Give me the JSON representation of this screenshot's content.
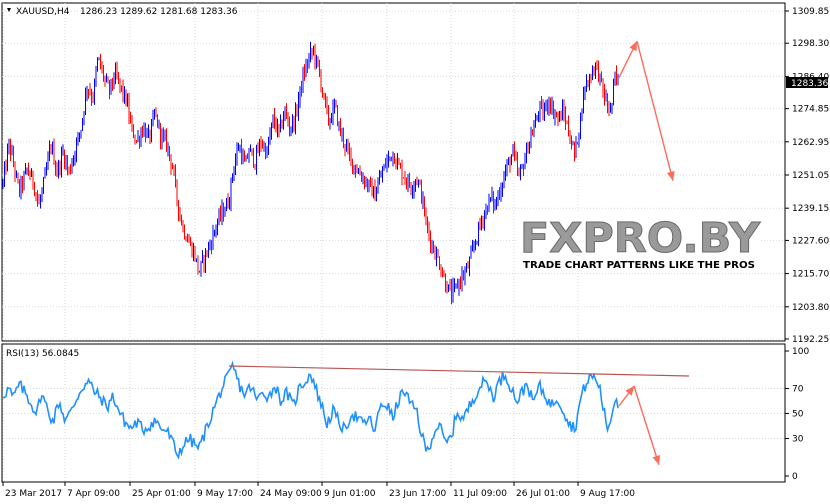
{
  "header": {
    "symbol": "XAUUSD,H4",
    "ohlc": "1286.23 1289.62 1281.68 1283.36"
  },
  "rsi_header": "RSI(13) 56.0845",
  "price_marker": "1283.36",
  "watermark": {
    "brand": "FXPRO.BY",
    "tagline": "TRADE CHART PATTERNS LIKE THE PROS"
  },
  "colors": {
    "bull": "#0000ff",
    "bear": "#ff0000",
    "rsi": "#1e90ff",
    "arrow": "#ff6a5a",
    "trendline": "#b85450",
    "grid": "#d9d9d9"
  },
  "chart_data": [
    {
      "type": "candlestick",
      "title": "XAUUSD,H4",
      "ylim": [
        1192.25,
        1309.85
      ],
      "y_ticks": [
        "1309.85",
        "1298.30",
        "1286.40",
        "1274.85",
        "1262.95",
        "1251.05",
        "1239.15",
        "1227.60",
        "1215.70",
        "1203.80",
        "1192.25"
      ],
      "x_ticks": [
        "23 Mar 2017",
        "7 Apr 09:00",
        "25 Apr 01:00",
        "9 May 17:00",
        "24 May 09:00",
        "9 Jun 01:00",
        "23 Jun 17:00",
        "11 Jul 09:00",
        "26 Jul 01:00",
        "9 Aug 17:00"
      ],
      "path": [
        [
          0,
          1248
        ],
        [
          6,
          1262
        ],
        [
          10,
          1256
        ],
        [
          16,
          1245
        ],
        [
          24,
          1253
        ],
        [
          30,
          1249
        ],
        [
          36,
          1240
        ],
        [
          42,
          1250
        ],
        [
          48,
          1262
        ],
        [
          54,
          1252
        ],
        [
          60,
          1259
        ],
        [
          66,
          1252
        ],
        [
          72,
          1260
        ],
        [
          78,
          1268
        ],
        [
          84,
          1283
        ],
        [
          90,
          1279
        ],
        [
          95,
          1293
        ],
        [
          100,
          1287
        ],
        [
          106,
          1281
        ],
        [
          112,
          1287
        ],
        [
          118,
          1282
        ],
        [
          124,
          1277
        ],
        [
          128,
          1268
        ],
        [
          134,
          1263
        ],
        [
          140,
          1268
        ],
        [
          146,
          1264
        ],
        [
          152,
          1273
        ],
        [
          158,
          1265
        ],
        [
          164,
          1262
        ],
        [
          170,
          1253
        ],
        [
          175,
          1240
        ],
        [
          180,
          1232
        ],
        [
          186,
          1227
        ],
        [
          192,
          1222
        ],
        [
          196,
          1216
        ],
        [
          202,
          1222
        ],
        [
          208,
          1227
        ],
        [
          214,
          1234
        ],
        [
          220,
          1238
        ],
        [
          226,
          1242
        ],
        [
          230,
          1253
        ],
        [
          236,
          1262
        ],
        [
          242,
          1254
        ],
        [
          246,
          1260
        ],
        [
          252,
          1256
        ],
        [
          258,
          1263
        ],
        [
          264,
          1259
        ],
        [
          270,
          1271
        ],
        [
          276,
          1266
        ],
        [
          282,
          1274
        ],
        [
          286,
          1268
        ],
        [
          292,
          1271
        ],
        [
          296,
          1279
        ],
        [
          300,
          1286
        ],
        [
          306,
          1293
        ],
        [
          310,
          1296
        ],
        [
          316,
          1288
        ],
        [
          322,
          1276
        ],
        [
          326,
          1270
        ],
        [
          332,
          1276
        ],
        [
          336,
          1268
        ],
        [
          342,
          1262
        ],
        [
          348,
          1256
        ],
        [
          354,
          1253
        ],
        [
          360,
          1250
        ],
        [
          366,
          1247
        ],
        [
          372,
          1244
        ],
        [
          378,
          1251
        ],
        [
          384,
          1256
        ],
        [
          390,
          1259
        ],
        [
          396,
          1254
        ],
        [
          402,
          1250
        ],
        [
          408,
          1247
        ],
        [
          414,
          1250
        ],
        [
          418,
          1245
        ],
        [
          424,
          1232
        ],
        [
          430,
          1225
        ],
        [
          436,
          1220
        ],
        [
          442,
          1213
        ],
        [
          448,
          1208
        ],
        [
          452,
          1210
        ],
        [
          458,
          1214
        ],
        [
          464,
          1217
        ],
        [
          470,
          1224
        ],
        [
          476,
          1232
        ],
        [
          482,
          1238
        ],
        [
          488,
          1243
        ],
        [
          492,
          1240
        ],
        [
          498,
          1247
        ],
        [
          504,
          1254
        ],
        [
          510,
          1259
        ],
        [
          516,
          1250
        ],
        [
          522,
          1257
        ],
        [
          526,
          1263
        ],
        [
          532,
          1269
        ],
        [
          536,
          1275
        ],
        [
          540,
          1273
        ],
        [
          546,
          1278
        ],
        [
          550,
          1274
        ],
        [
          556,
          1271
        ],
        [
          560,
          1274
        ],
        [
          566,
          1266
        ],
        [
          572,
          1258
        ],
        [
          578,
          1273
        ],
        [
          582,
          1283
        ],
        [
          588,
          1287
        ],
        [
          592,
          1291
        ],
        [
          596,
          1287
        ],
        [
          600,
          1281
        ],
        [
          604,
          1276
        ],
        [
          608,
          1274
        ],
        [
          612,
          1286
        ],
        [
          616,
          1284
        ]
      ],
      "projection_arrows": [
        {
          "from": [
            616,
            1286
          ],
          "to": [
            634,
            1299
          ]
        },
        {
          "from": [
            634,
            1299
          ],
          "to": [
            670,
            1249
          ]
        }
      ]
    },
    {
      "type": "line",
      "title": "RSI(13) 56.0845",
      "ylim": [
        0,
        100
      ],
      "y_ticks": [
        "100",
        "70",
        "50",
        "30",
        "0"
      ],
      "series": [
        {
          "values": [
            [
              0,
              65
            ],
            [
              6,
              70
            ],
            [
              10,
              62
            ],
            [
              16,
              73
            ],
            [
              22,
              67
            ],
            [
              28,
              58
            ],
            [
              34,
              50
            ],
            [
              38,
              66
            ],
            [
              44,
              55
            ],
            [
              50,
              43
            ],
            [
              56,
              60
            ],
            [
              62,
              45
            ],
            [
              68,
              51
            ],
            [
              74,
              63
            ],
            [
              80,
              72
            ],
            [
              86,
              75
            ],
            [
              92,
              67
            ],
            [
              98,
              62
            ],
            [
              104,
              55
            ],
            [
              110,
              64
            ],
            [
              116,
              52
            ],
            [
              122,
              43
            ],
            [
              128,
              38
            ],
            [
              134,
              43
            ],
            [
              140,
              37
            ],
            [
              146,
              40
            ],
            [
              152,
              45
            ],
            [
              158,
              38
            ],
            [
              164,
              36
            ],
            [
              170,
              26
            ],
            [
              174,
              17
            ],
            [
              180,
              24
            ],
            [
              186,
              30
            ],
            [
              192,
              25
            ],
            [
              196,
              22
            ],
            [
              202,
              35
            ],
            [
              208,
              48
            ],
            [
              214,
              60
            ],
            [
              220,
              72
            ],
            [
              226,
              80
            ],
            [
              230,
              88
            ],
            [
              236,
              73
            ],
            [
              242,
              65
            ],
            [
              248,
              72
            ],
            [
              254,
              60
            ],
            [
              260,
              68
            ],
            [
              266,
              63
            ],
            [
              272,
              73
            ],
            [
              278,
              60
            ],
            [
              284,
              67
            ],
            [
              290,
              55
            ],
            [
              296,
              70
            ],
            [
              302,
              76
            ],
            [
              308,
              82
            ],
            [
              312,
              72
            ],
            [
              318,
              58
            ],
            [
              324,
              42
            ],
            [
              330,
              52
            ],
            [
              336,
              43
            ],
            [
              342,
              36
            ],
            [
              348,
              50
            ],
            [
              354,
              47
            ],
            [
              360,
              41
            ],
            [
              366,
              46
            ],
            [
              372,
              36
            ],
            [
              378,
              58
            ],
            [
              384,
              57
            ],
            [
              390,
              46
            ],
            [
              396,
              62
            ],
            [
              402,
              68
            ],
            [
              408,
              56
            ],
            [
              414,
              52
            ],
            [
              418,
              34
            ],
            [
              424,
              19
            ],
            [
              430,
              33
            ],
            [
              436,
              42
            ],
            [
              442,
              26
            ],
            [
              448,
              30
            ],
            [
              454,
              52
            ],
            [
              460,
              45
            ],
            [
              466,
              55
            ],
            [
              472,
              65
            ],
            [
              478,
              73
            ],
            [
              484,
              76
            ],
            [
              490,
              63
            ],
            [
              496,
              75
            ],
            [
              502,
              82
            ],
            [
              508,
              71
            ],
            [
              514,
              60
            ],
            [
              520,
              68
            ],
            [
              524,
              75
            ],
            [
              530,
              58
            ],
            [
              536,
              72
            ],
            [
              542,
              65
            ],
            [
              548,
              56
            ],
            [
              554,
              63
            ],
            [
              560,
              54
            ],
            [
              566,
              42
            ],
            [
              572,
              38
            ],
            [
              578,
              63
            ],
            [
              582,
              72
            ],
            [
              588,
              80
            ],
            [
              592,
              78
            ],
            [
              596,
              73
            ],
            [
              600,
              56
            ],
            [
              604,
              38
            ],
            [
              608,
              45
            ],
            [
              612,
              63
            ],
            [
              616,
              56
            ]
          ]
        }
      ],
      "trendline": {
        "from": [
          226,
          88
        ],
        "to": [
          686,
          80
        ]
      },
      "projection_arrows": [
        {
          "from": [
            616,
            56
          ],
          "to": [
            631,
            72
          ]
        },
        {
          "from": [
            631,
            72
          ],
          "to": [
            656,
            9
          ]
        }
      ]
    }
  ]
}
